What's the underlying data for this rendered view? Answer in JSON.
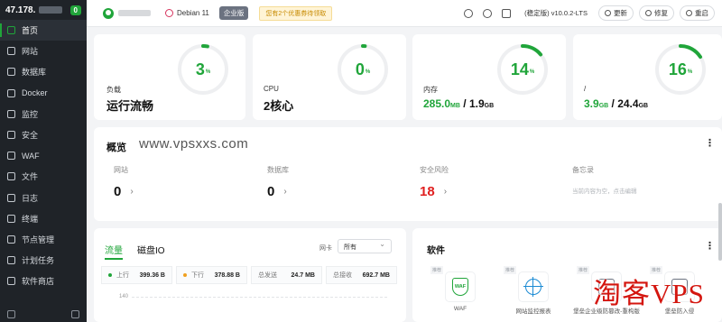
{
  "sidebar": {
    "server_ip": "47.178.",
    "badge": "0",
    "items": [
      {
        "label": "首页",
        "icon": "home-icon",
        "active": true
      },
      {
        "label": "网站",
        "icon": "globe-icon"
      },
      {
        "label": "数据库",
        "icon": "database-icon"
      },
      {
        "label": "Docker",
        "icon": "docker-icon"
      },
      {
        "label": "监控",
        "icon": "monitor-icon"
      },
      {
        "label": "安全",
        "icon": "shield-icon"
      },
      {
        "label": "WAF",
        "icon": "waf-icon"
      },
      {
        "label": "文件",
        "icon": "folder-icon"
      },
      {
        "label": "日志",
        "icon": "log-icon"
      },
      {
        "label": "终端",
        "icon": "terminal-icon"
      },
      {
        "label": "节点管理",
        "icon": "node-icon"
      },
      {
        "label": "计划任务",
        "icon": "clock-icon"
      },
      {
        "label": "软件商店",
        "icon": "store-icon"
      }
    ]
  },
  "topbar": {
    "os": "Debian 11",
    "edition_badge": "企业版",
    "promo": "您有2个优惠券待领取",
    "version": "(稳定版) v10.0.2-LTS",
    "buttons": {
      "update": "更新",
      "repair": "修复",
      "restart": "重启"
    }
  },
  "stats": [
    {
      "label": "负载",
      "value": "运行流畅",
      "gauge": 3,
      "unit": "%"
    },
    {
      "label": "CPU",
      "value": "2核心",
      "gauge": 0,
      "unit": "%"
    },
    {
      "label": "内存",
      "used": "285.0",
      "used_unit": "MB",
      "total": "1.9",
      "total_unit": "GB",
      "gauge": 14,
      "unit": "%"
    },
    {
      "label": "/",
      "used": "3.9",
      "used_unit": "GB",
      "total": "24.4",
      "total_unit": "GB",
      "gauge": 16,
      "unit": "%"
    }
  ],
  "overview": {
    "title": "概览",
    "watermark": "www.vpsxxs.com",
    "sites_label": "网站",
    "sites_value": "0",
    "db_label": "数据库",
    "db_value": "0",
    "risk_label": "安全风险",
    "risk_value": "18",
    "memo_label": "备忘录",
    "memo_hint": "当前内容为空，点击编辑"
  },
  "traffic": {
    "tab_flow": "流量",
    "tab_disk": "磁盘IO",
    "nic_label": "网卡",
    "nic_value": "所有",
    "up_label": "上行",
    "up_value": "399.36 B",
    "down_label": "下行",
    "down_value": "378.88 B",
    "sent_label": "总发送",
    "sent_value": "24.7 MB",
    "recv_label": "总接收",
    "recv_value": "692.7 MB",
    "axis_top": "140",
    "up_color": "#20a53a",
    "down_color": "#f0a020"
  },
  "software": {
    "title": "软件",
    "rec_tag": "推荐",
    "items": [
      {
        "name": "WAF",
        "icon": "waf-icon"
      },
      {
        "name": "网站监控报表",
        "icon": "monitor-report-icon"
      },
      {
        "name": "堡垒企业级防篡改-重构版",
        "icon": "tamper-proof-icon"
      },
      {
        "name": "堡垒防入侵",
        "icon": "anti-intrusion-icon"
      }
    ]
  },
  "watermark_overlay": "淘客VPS",
  "colors": {
    "accent": "#20a53a",
    "danger": "#e02020",
    "sidebar_bg": "#1f2328"
  }
}
